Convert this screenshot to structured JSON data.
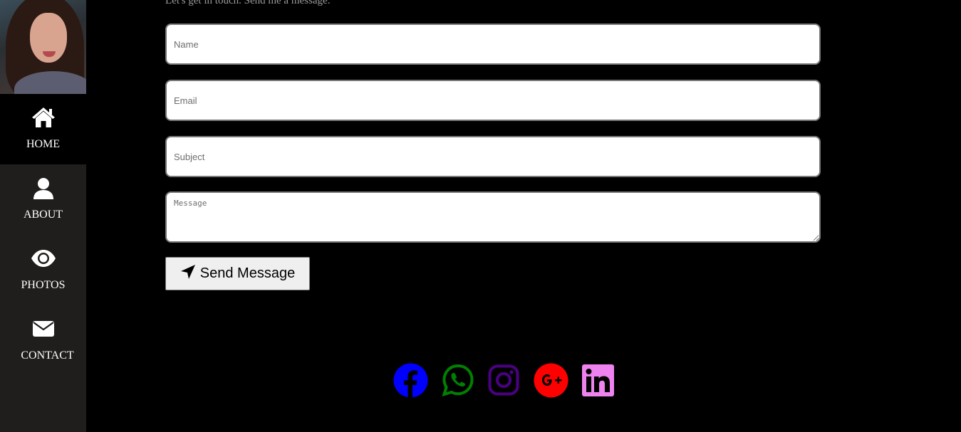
{
  "sidebar": {
    "items": [
      {
        "label": "HOME",
        "icon": "home-icon",
        "active": true
      },
      {
        "label": "ABOUT",
        "icon": "user-icon",
        "active": false
      },
      {
        "label": "PHOTOS",
        "icon": "eye-icon",
        "active": false
      },
      {
        "label": "CONTACT",
        "icon": "envelope-icon",
        "active": false
      }
    ]
  },
  "contact": {
    "intro": "Let's get in touch. Send me a message:",
    "name_placeholder": "Name",
    "email_placeholder": "Email",
    "subject_placeholder": "Subject",
    "message_placeholder": "Message",
    "send_label": "Send Message"
  },
  "social": [
    {
      "name": "facebook",
      "icon": "facebook-icon",
      "color": "#0000ff"
    },
    {
      "name": "whatsapp",
      "icon": "whatsapp-icon",
      "color": "#008000"
    },
    {
      "name": "instagram",
      "icon": "instagram-icon",
      "color": "#4b0082"
    },
    {
      "name": "google-plus",
      "icon": "google-plus-icon",
      "color": "#ff0000"
    },
    {
      "name": "linkedin",
      "icon": "linkedin-icon",
      "color": "#ee82ee"
    }
  ]
}
